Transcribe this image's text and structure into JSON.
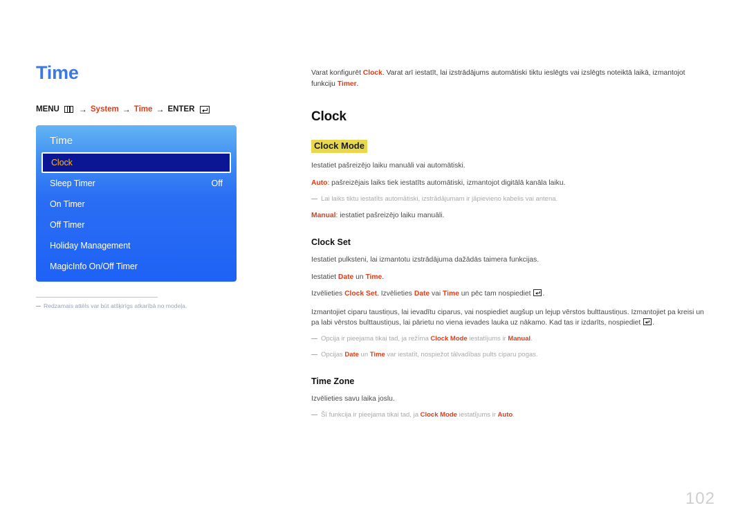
{
  "page": {
    "title": "Time",
    "number": "102"
  },
  "breadcrumb": {
    "menu_label": "MENU",
    "menu_icon": "menu-bars-icon",
    "arrow": "→",
    "item1": "System",
    "item2": "Time",
    "enter_label": "ENTER",
    "enter_icon": "enter-key-icon"
  },
  "osd": {
    "title": "Time",
    "rows": [
      {
        "label": "Clock",
        "value": "",
        "selected": true
      },
      {
        "label": "Sleep Timer",
        "value": "Off",
        "selected": false
      },
      {
        "label": "On Timer",
        "value": "",
        "selected": false
      },
      {
        "label": "Off Timer",
        "value": "",
        "selected": false
      },
      {
        "label": "Holiday Management",
        "value": "",
        "selected": false
      },
      {
        "label": "MagicInfo On/Off Timer",
        "value": "",
        "selected": false
      }
    ]
  },
  "image_footnote": "Redzamais attēls var būt atšķirīgs atkarībā no modeļa.",
  "content": {
    "intro_pre": "Varat konfigurēt ",
    "intro_kw1": "Clock",
    "intro_mid": ". Varat arī iestatīt, lai izstrādājums automātiski tiktu ieslēgts vai izslēgts noteiktā laikā, izmantojot funkciju ",
    "intro_kw2": "Timer",
    "intro_end": ".",
    "heading_clock": "Clock",
    "clock_mode": {
      "heading": "Clock Mode",
      "line1": "Iestatiet pašreizējo laiku manuāli vai automātiski.",
      "auto_kw": "Auto",
      "auto_text": ": pašreizējais laiks tiek iestatīts automātiski, izmantojot digitālā kanāla laiku.",
      "note1": "Lai laiks tiktu iestatīts automātiski, izstrādājumam ir jāpievieno kabelis vai antena.",
      "manual_kw": "Manual",
      "manual_text": ": iestatiet pašreizējo laiku manuāli."
    },
    "clock_set": {
      "heading": "Clock Set",
      "line1": "Iestatiet pulksteni, lai izmantotu izstrādājuma dažādās taimera funkcijas.",
      "line2_pre": "Iestatiet ",
      "line2_kw1": "Date",
      "line2_mid": " un ",
      "line2_kw2": "Time",
      "line2_end": ".",
      "line3_pre": "Izvēlieties ",
      "line3_kw1": "Clock Set",
      "line3_mid1": ". Izvēlieties ",
      "line3_kw2": "Date",
      "line3_mid2": " vai ",
      "line3_kw3": "Time",
      "line3_end": " un pēc tam nospiediet ",
      "line3_tail": ".",
      "para_pre": "Izmantojiet ciparu taustiņus, lai ievadītu ciparus, vai nospiediet augšup un lejup vērstos bulttaustiņus. Izmantojiet pa kreisi un pa labi vērstos bulttaustiņus, lai pārietu no viena ievades lauka uz nākamo. Kad tas ir izdarīts, nospiediet ",
      "para_tail": ".",
      "note1_pre": "Opcija ir pieejama tikai tad, ja režīma ",
      "note1_kw1": "Clock Mode",
      "note1_mid": " iestatījums ir ",
      "note1_kw2": "Manual",
      "note1_end": ".",
      "note2_pre": "Opcijas ",
      "note2_kw1": "Date",
      "note2_mid": " un ",
      "note2_kw2": "Time",
      "note2_end": " var iestatīt, nospiežot tālvadības pults ciparu pogas."
    },
    "time_zone": {
      "heading": "Time Zone",
      "line1": "Izvēlieties savu laika joslu.",
      "note_pre": "Šī funkcija ir pieejama tikai tad, ja ",
      "note_kw1": "Clock Mode",
      "note_mid": " iestatījums ir ",
      "note_kw2": "Auto",
      "note_end": "."
    }
  },
  "colors": {
    "title_blue": "#3b7ae0",
    "keyword_red": "#e03c18",
    "highlight_yellow": "#e8d84d",
    "osd_selected_bg": "#0b1694",
    "osd_selected_text": "#ffb61e"
  }
}
